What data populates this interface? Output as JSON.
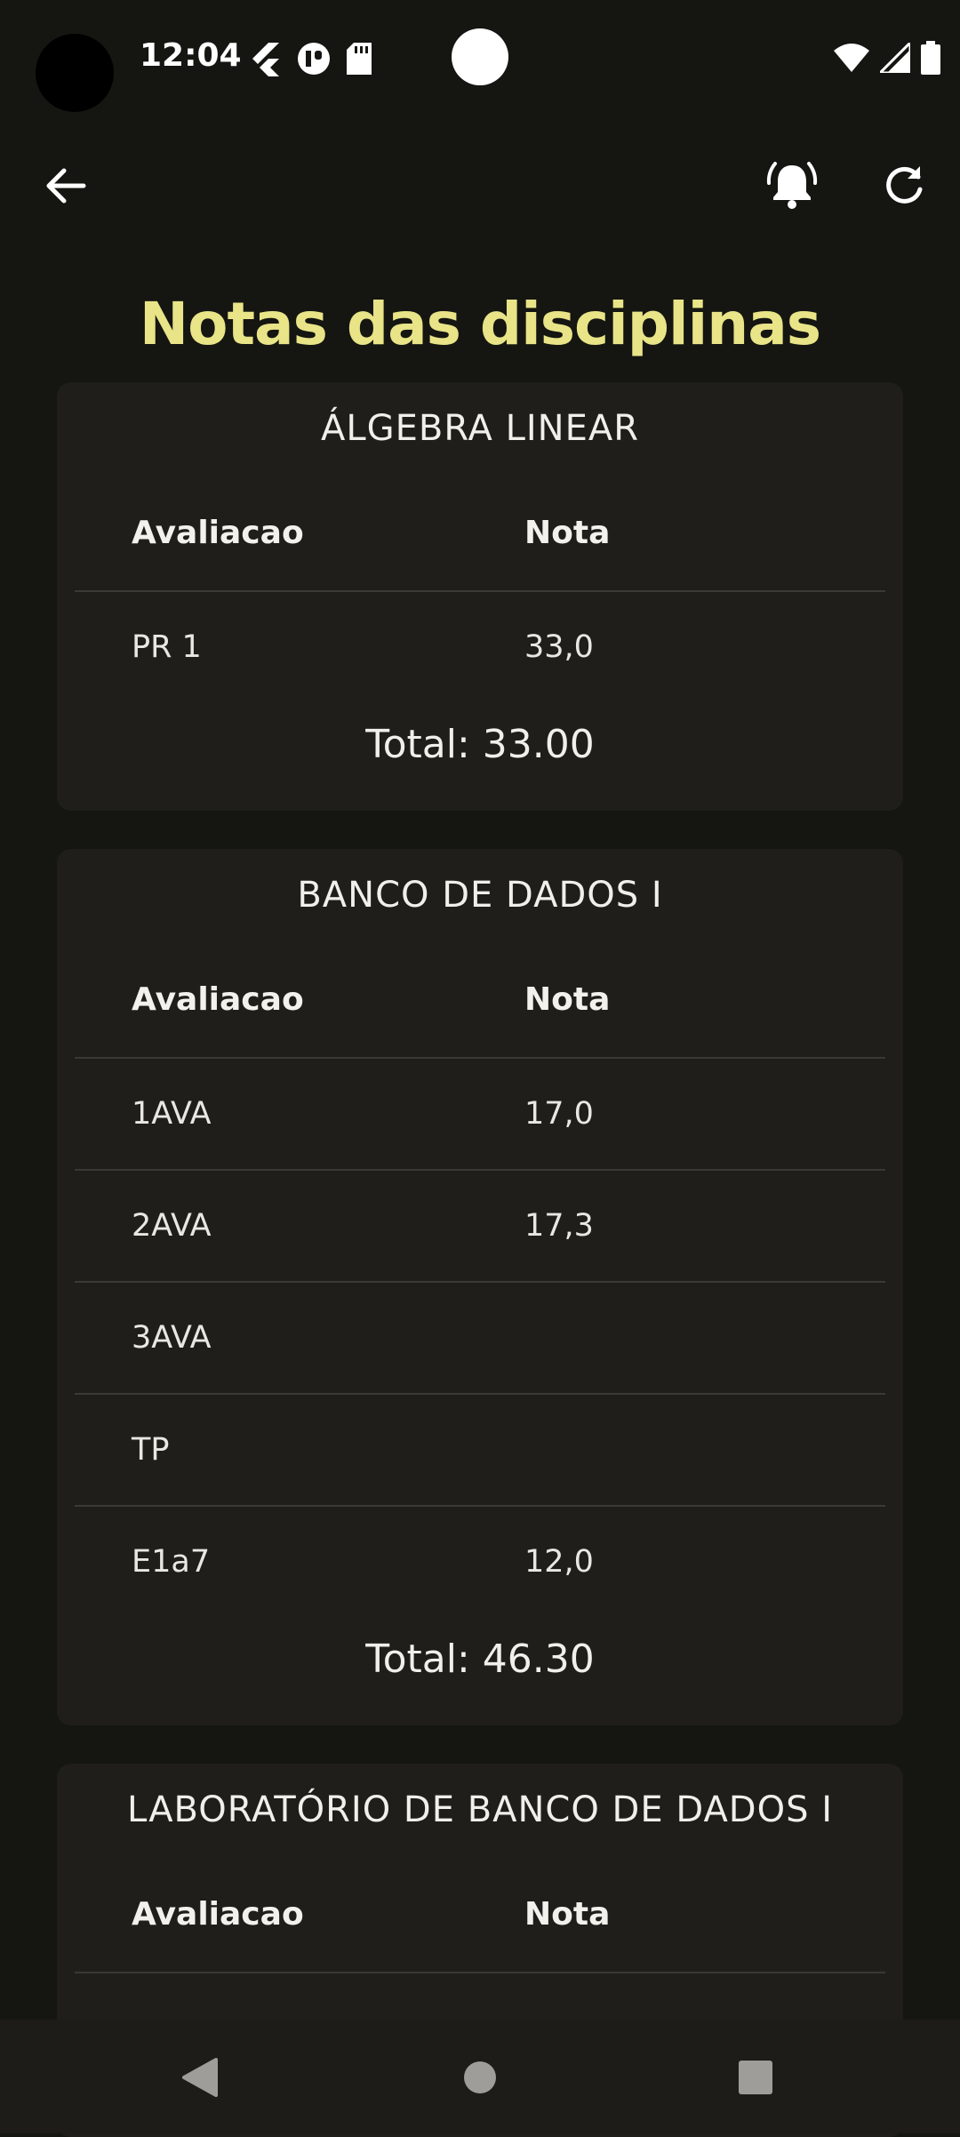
{
  "status_bar": {
    "time": "12:04"
  },
  "page": {
    "title": "Notas das disciplinas"
  },
  "columns": {
    "evaluation": "Avaliacao",
    "grade": "Nota"
  },
  "courses": [
    {
      "name": "ÁLGEBRA LINEAR",
      "rows": [
        {
          "evaluation": "PR 1",
          "grade": "33,0"
        }
      ],
      "total": "Total: 33.00"
    },
    {
      "name": "BANCO DE DADOS I",
      "rows": [
        {
          "evaluation": "1AVA",
          "grade": "17,0"
        },
        {
          "evaluation": "2AVA",
          "grade": "17,3"
        },
        {
          "evaluation": "3AVA",
          "grade": ""
        },
        {
          "evaluation": "TP",
          "grade": ""
        },
        {
          "evaluation": "E1a7",
          "grade": "12,0"
        }
      ],
      "total": "Total: 46.30"
    },
    {
      "name": "LABORATÓRIO DE BANCO DE DADOS I",
      "rows": [],
      "total": ""
    }
  ],
  "icons": {
    "back": "arrow-back-icon",
    "notifications": "bell-ringing-icon",
    "refresh": "refresh-icon"
  },
  "colors": {
    "accent": "#e8e487",
    "background": "#151512",
    "card": "#1f1e1b"
  }
}
